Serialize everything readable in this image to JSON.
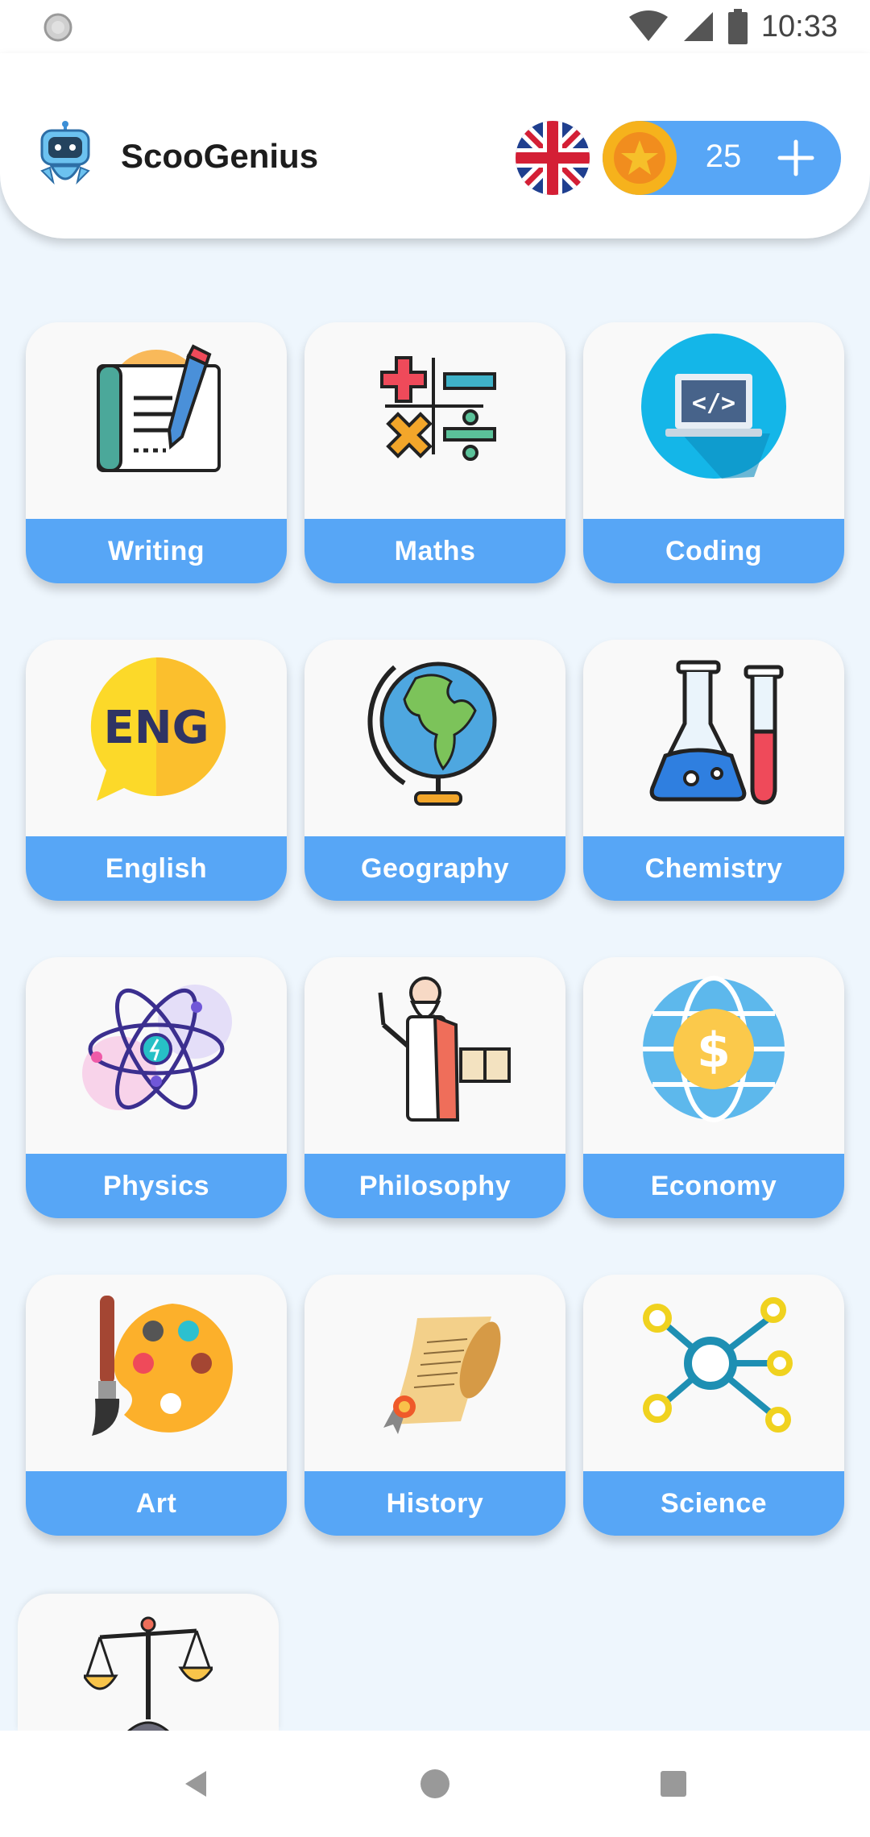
{
  "status_bar": {
    "time": "10:33",
    "icons": [
      "sync-icon",
      "wifi-icon",
      "signal-icon",
      "battery-icon"
    ]
  },
  "header": {
    "app_title": "ScooGenius",
    "logo_icon": "robot-mascot-icon",
    "language_flag_icon": "uk-flag-icon",
    "coins": {
      "count": "25",
      "coin_icon": "star-coin-icon",
      "add_icon": "plus-icon"
    }
  },
  "subjects": [
    {
      "label": "Writing",
      "icon": "writing-icon"
    },
    {
      "label": "Maths",
      "icon": "math-symbols-icon"
    },
    {
      "label": "Coding",
      "icon": "laptop-code-icon"
    },
    {
      "label": "English",
      "icon": "eng-speech-bubble-icon"
    },
    {
      "label": "Geography",
      "icon": "globe-icon"
    },
    {
      "label": "Chemistry",
      "icon": "flask-test-tube-icon"
    },
    {
      "label": "Physics",
      "icon": "atom-icon"
    },
    {
      "label": "Philosophy",
      "icon": "philosopher-book-icon"
    },
    {
      "label": "Economy",
      "icon": "dollar-globe-icon"
    },
    {
      "label": "Art",
      "icon": "palette-brush-icon"
    },
    {
      "label": "History",
      "icon": "scroll-icon"
    },
    {
      "label": "Science",
      "icon": "network-icon"
    }
  ],
  "partial_card": {
    "icon": "scales-icon"
  },
  "nav": {
    "icons": [
      "back-icon",
      "home-icon",
      "recents-icon"
    ]
  },
  "colors": {
    "accent": "#57a6f6",
    "background": "#eef6fd",
    "card": "#f9f9f9"
  }
}
